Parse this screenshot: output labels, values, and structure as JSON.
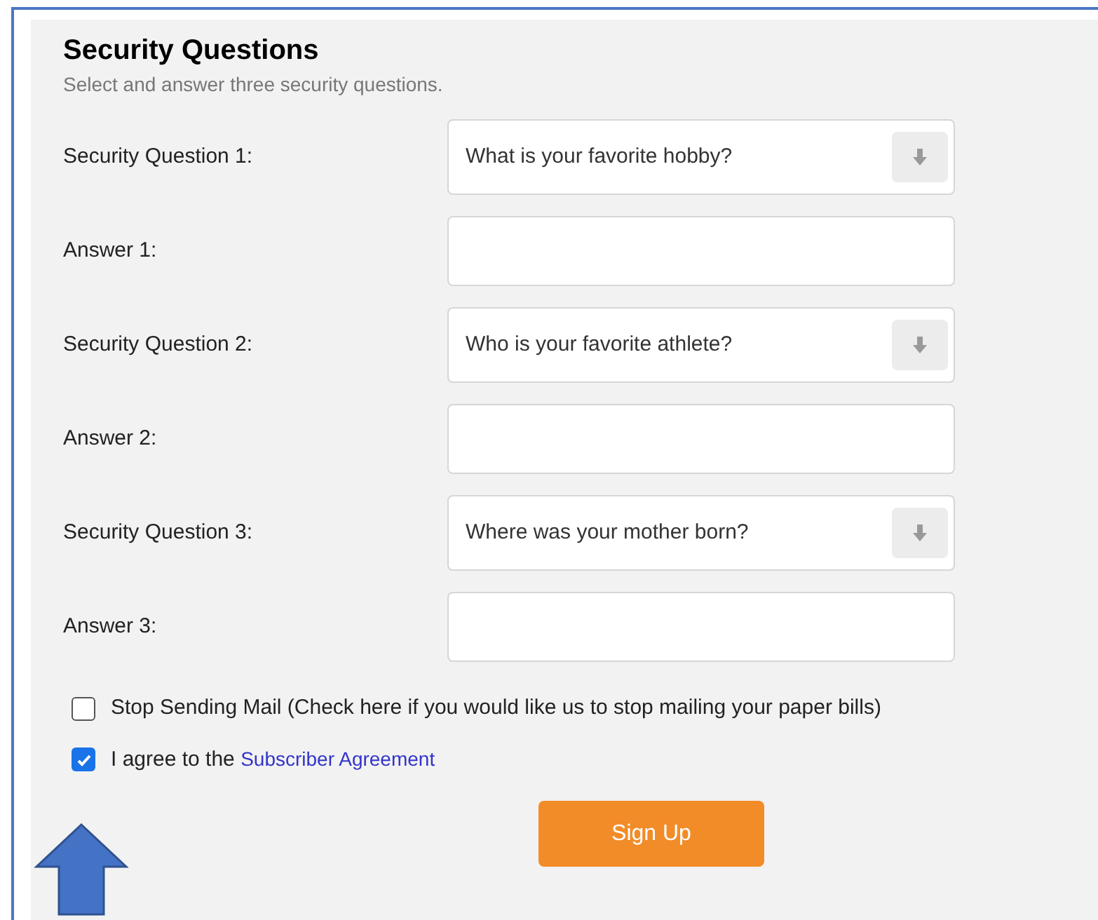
{
  "section": {
    "title": "Security Questions",
    "subtitle": "Select and answer three security questions."
  },
  "fields": [
    {
      "kind": "select",
      "label": "Security Question 1:",
      "value": "What is your favorite hobby?"
    },
    {
      "kind": "text",
      "label": "Answer 1:"
    },
    {
      "kind": "select",
      "label": "Security Question 2:",
      "value": "Who is your favorite athlete?"
    },
    {
      "kind": "text",
      "label": "Answer 2:"
    },
    {
      "kind": "select",
      "label": "Security Question 3:",
      "value": "Where was your mother born?"
    },
    {
      "kind": "text",
      "label": "Answer 3:"
    }
  ],
  "options": [
    {
      "label": "Stop Sending Mail (Check here if you would like us to stop mailing your paper bills)",
      "checked": false
    },
    {
      "label": "I agree to the ",
      "link": "Subscriber Agreement",
      "checked": true
    }
  ],
  "submit": "Sign Up"
}
